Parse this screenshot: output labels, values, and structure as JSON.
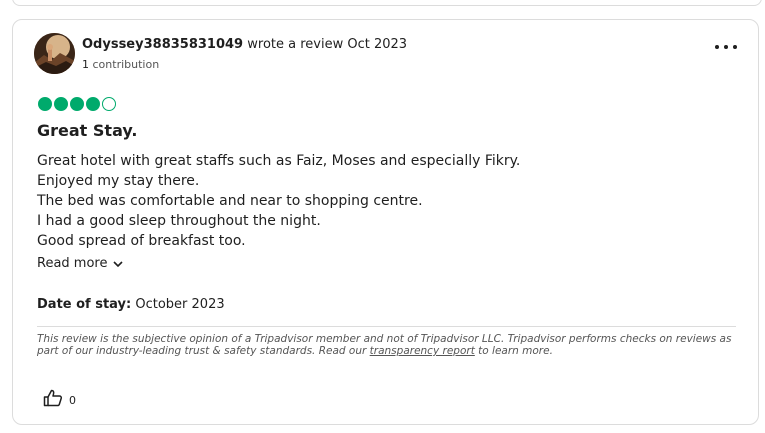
{
  "review": {
    "author": "Odyssey38835831049",
    "author_suffix": "wrote a review Oct 2023",
    "contributions_count": "1",
    "contributions_label": "contribution",
    "rating": 4,
    "rating_max": 5,
    "title": "Great Stay.",
    "body_lines": [
      "Great hotel with great staffs such as Faiz, Moses and especially Fikry.",
      "Enjoyed my stay there.",
      "The bed was comfortable and near to shopping centre.",
      "I had a good sleep throughout the night.",
      "Good spread of breakfast too."
    ],
    "read_more": "Read more",
    "date_of_stay_label": "Date of stay:",
    "date_of_stay_value": "October 2023",
    "disclaimer_pre": "This review is the subjective opinion of a Tripadvisor member and not of Tripadvisor LLC. Tripadvisor performs checks on reviews as part of our industry-leading trust & safety standards. Read our",
    "disclaimer_link": "transparency report",
    "disclaimer_post": "to learn more.",
    "helpful_count": "0"
  },
  "icons": {
    "more": "more-horizontal-icon",
    "read_more": "chevron-down-icon",
    "helpful": "thumbs-up-icon"
  },
  "colors": {
    "bubble": "#00aa6c",
    "text": "#1f1f1f",
    "border": "#dcdcdc"
  }
}
